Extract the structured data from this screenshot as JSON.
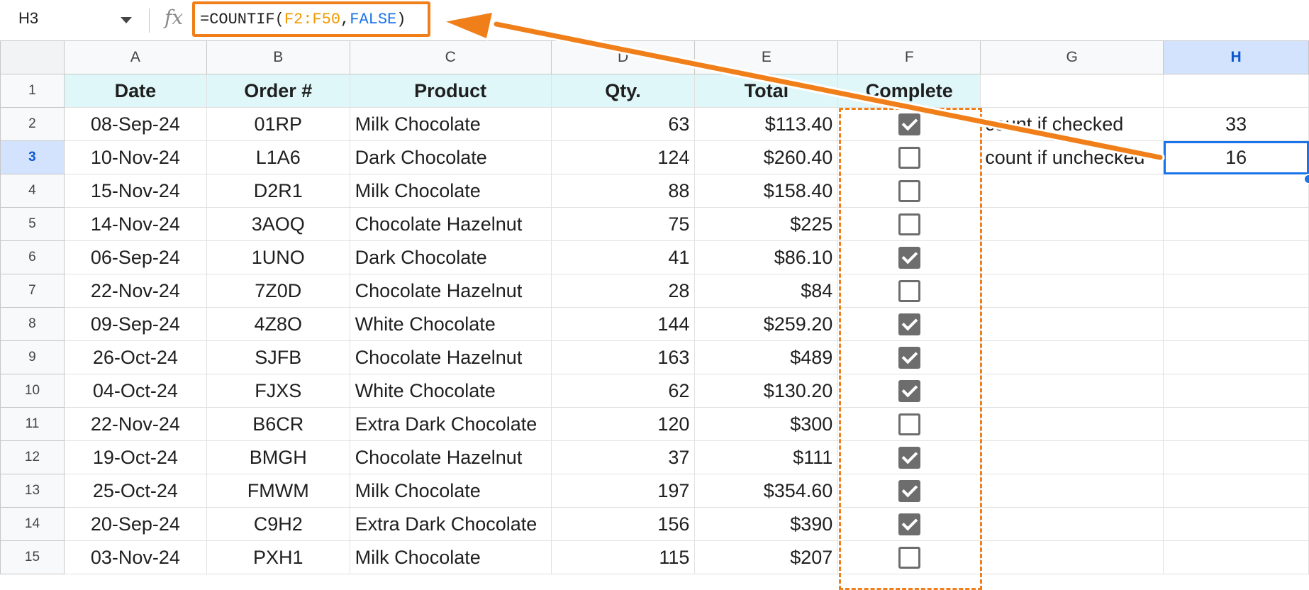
{
  "name_box": {
    "cell_ref": "H3"
  },
  "formula_bar": {
    "fx_label": "fx",
    "prefix": "=COUNTIF(",
    "range": "F2:F50",
    "comma": ",",
    "bool": "FALSE",
    "suffix": ")"
  },
  "columns": [
    "A",
    "B",
    "C",
    "D",
    "E",
    "F",
    "G",
    "H"
  ],
  "selected_column": "H",
  "selected_row": "3",
  "headers": {
    "date": "Date",
    "order": "Order #",
    "product": "Product",
    "qty": "Qty.",
    "total": "Total",
    "complete": "Complete"
  },
  "rows": [
    {
      "n": "2",
      "date": "08-Sep-24",
      "order": "01RP",
      "product": "Milk Chocolate",
      "qty": "63",
      "total": "$113.40",
      "complete": true
    },
    {
      "n": "3",
      "date": "10-Nov-24",
      "order": "L1A6",
      "product": "Dark Chocolate",
      "qty": "124",
      "total": "$260.40",
      "complete": false
    },
    {
      "n": "4",
      "date": "15-Nov-24",
      "order": "D2R1",
      "product": "Milk Chocolate",
      "qty": "88",
      "total": "$158.40",
      "complete": false
    },
    {
      "n": "5",
      "date": "14-Nov-24",
      "order": "3AOQ",
      "product": "Chocolate Hazelnut",
      "qty": "75",
      "total": "$225",
      "complete": false
    },
    {
      "n": "6",
      "date": "06-Sep-24",
      "order": "1UNO",
      "product": "Dark Chocolate",
      "qty": "41",
      "total": "$86.10",
      "complete": true
    },
    {
      "n": "7",
      "date": "22-Nov-24",
      "order": "7Z0D",
      "product": "Chocolate Hazelnut",
      "qty": "28",
      "total": "$84",
      "complete": false
    },
    {
      "n": "8",
      "date": "09-Sep-24",
      "order": "4Z8O",
      "product": "White Chocolate",
      "qty": "144",
      "total": "$259.20",
      "complete": true
    },
    {
      "n": "9",
      "date": "26-Oct-24",
      "order": "SJFB",
      "product": "Chocolate Hazelnut",
      "qty": "163",
      "total": "$489",
      "complete": true
    },
    {
      "n": "10",
      "date": "04-Oct-24",
      "order": "FJXS",
      "product": "White Chocolate",
      "qty": "62",
      "total": "$130.20",
      "complete": true
    },
    {
      "n": "11",
      "date": "22-Nov-24",
      "order": "B6CR",
      "product": "Extra Dark Chocolate",
      "qty": "120",
      "total": "$300",
      "complete": false
    },
    {
      "n": "12",
      "date": "19-Oct-24",
      "order": "BMGH",
      "product": "Chocolate Hazelnut",
      "qty": "37",
      "total": "$111",
      "complete": true
    },
    {
      "n": "13",
      "date": "25-Oct-24",
      "order": "FMWM",
      "product": "Milk Chocolate",
      "qty": "197",
      "total": "$354.60",
      "complete": true
    },
    {
      "n": "14",
      "date": "20-Sep-24",
      "order": "C9H2",
      "product": "Extra Dark Chocolate",
      "qty": "156",
      "total": "$390",
      "complete": true
    },
    {
      "n": "15",
      "date": "03-Nov-24",
      "order": "PXH1",
      "product": "Milk Chocolate",
      "qty": "115",
      "total": "$207",
      "complete": false
    }
  ],
  "summary": {
    "checked_label": "count if checked",
    "checked_value": "33",
    "unchecked_label": "count if unchecked",
    "unchecked_value": "16"
  },
  "colors": {
    "accent": "#f07f1a",
    "selection": "#1a73e8",
    "header_fill": "#e0f7fa"
  }
}
